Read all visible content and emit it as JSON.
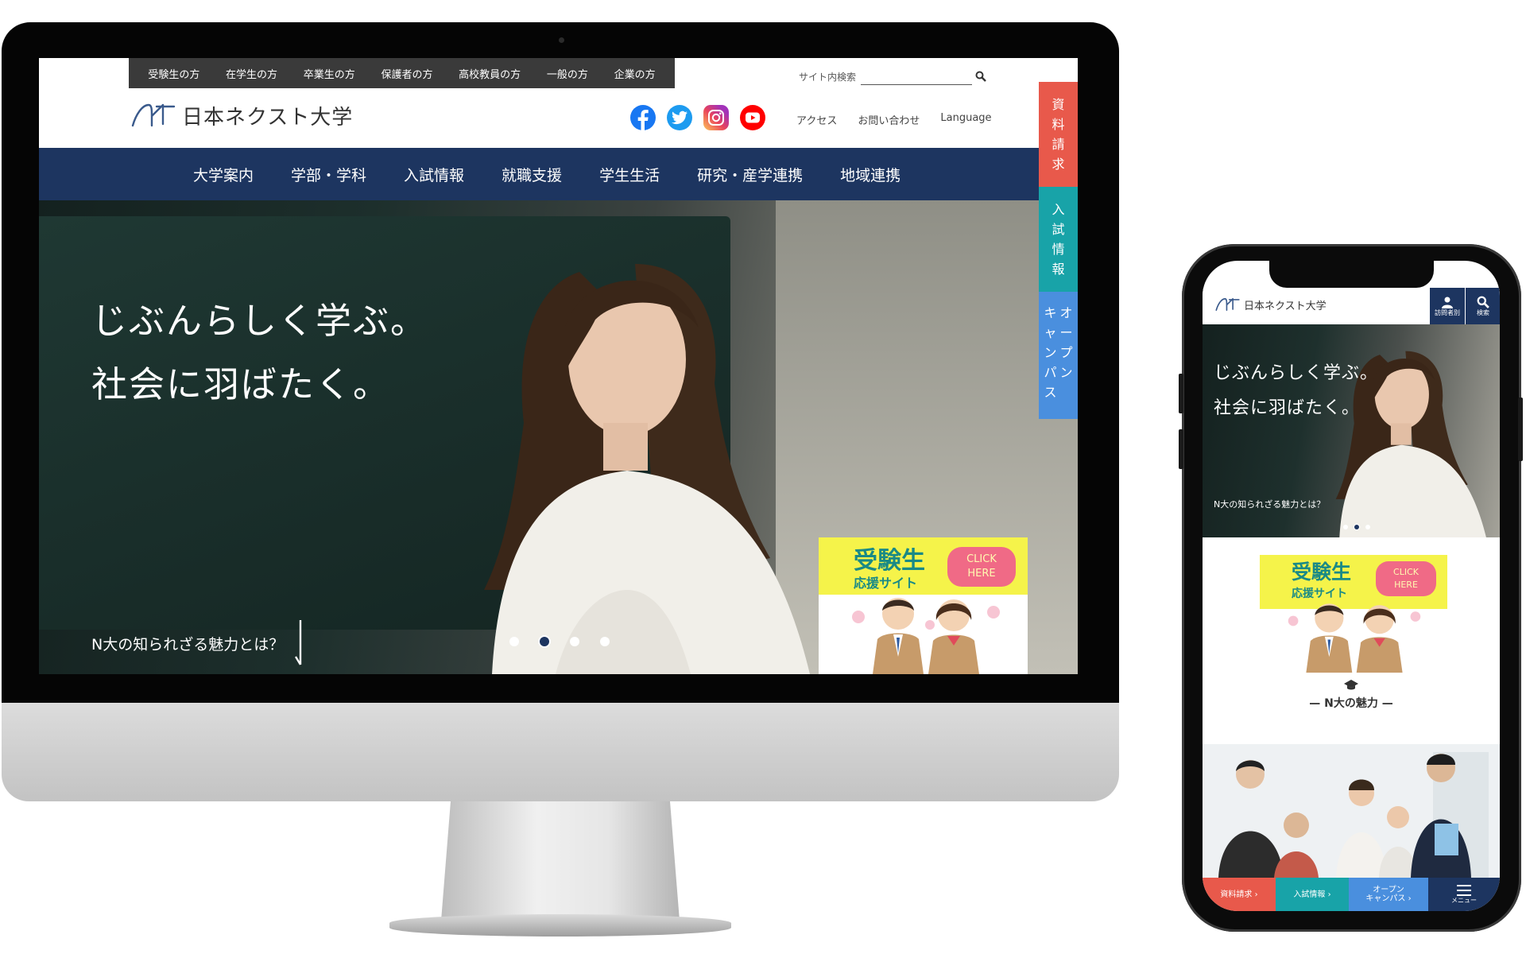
{
  "desktop": {
    "audience_links": [
      "受験生の方",
      "在学生の方",
      "卒業生の方",
      "保護者の方",
      "高校教員の方",
      "一般の方",
      "企業の方"
    ],
    "search": {
      "label": "サイト内検索",
      "placeholder": ""
    },
    "logo_text": "日本ネクスト大学",
    "utility_links": [
      "アクセス",
      "お問い合わせ",
      "Language"
    ],
    "main_nav": [
      "大学案内",
      "学部・学科",
      "入試情報",
      "就職支援",
      "学生生活",
      "研究・産学連携",
      "地域連携"
    ],
    "hero": {
      "headline_1": "じぶんらしく学ぶ。",
      "headline_2": "社会に羽ばたく。",
      "more_link": "N大の知られざる魅力とは？",
      "slide_count": 4,
      "active_slide": 2
    },
    "banner": {
      "title": "受験生",
      "subtitle": "応援サイト",
      "click_label_1": "CLICK",
      "click_label_2": "HERE"
    },
    "side_tabs": [
      {
        "label": [
          "資",
          "料",
          "請",
          "求"
        ],
        "color": "#e8594b"
      },
      {
        "label": [
          "入",
          "試",
          "情",
          "報"
        ],
        "color": "#18a3a8"
      },
      {
        "label": [
          "キ",
          "ャ",
          "ン",
          "パ",
          "ス"
        ],
        "label_right": [
          "オ",
          "ー",
          "プ",
          "ン"
        ],
        "color": "#4a8fde"
      }
    ]
  },
  "mobile": {
    "logo_text": "日本ネクスト大学",
    "header_buttons": [
      "訪問者別",
      "検索"
    ],
    "hero": {
      "headline_1": "じぶんらしく学ぶ。",
      "headline_2": "社会に羽ばたく。",
      "more_link": "N大の知られざる魅力とは？",
      "slide_count": 3,
      "active_slide": 2
    },
    "banner": {
      "title": "受験生",
      "subtitle": "応援サイト",
      "click_label_1": "CLICK",
      "click_label_2": "HERE"
    },
    "section_title": "— N大の魅力 —",
    "bottom_bar": [
      {
        "label": "資料請求 ›",
        "color": "#e8594b"
      },
      {
        "label": "入試情報 ›",
        "color": "#18a3a8"
      },
      {
        "label": "オープン\nキャンパス ›",
        "color": "#4a8fde"
      },
      {
        "label": "メニュー",
        "color": "#1d3560"
      }
    ]
  },
  "colors": {
    "navy": "#1d3560",
    "red": "#e8594b",
    "teal": "#18a3a8",
    "blue": "#4a8fde",
    "banner_yellow": "#f5f34a",
    "banner_pink": "#f06a86"
  }
}
